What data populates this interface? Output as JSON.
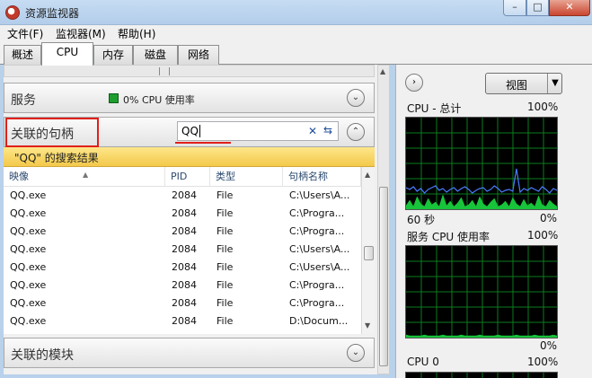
{
  "window": {
    "title": "资源监视器",
    "min_glyph": "–",
    "max_glyph": "□",
    "close_glyph": "✕"
  },
  "menu": [
    {
      "label": "文件(F)"
    },
    {
      "label": "监视器(M)"
    },
    {
      "label": "帮助(H)"
    }
  ],
  "tabs": [
    {
      "label": "概述",
      "active": false
    },
    {
      "label": "CPU",
      "active": true
    },
    {
      "label": "内存",
      "active": false
    },
    {
      "label": "磁盘",
      "active": false
    },
    {
      "label": "网络",
      "active": false
    }
  ],
  "services": {
    "title": "服务",
    "cpu_usage": "0% CPU 使用率",
    "indicator_color": "#1e9e2e"
  },
  "handles": {
    "title": "关联的句柄",
    "search_value": "QQ",
    "results_text": "\"QQ\" 的搜索结果",
    "columns": [
      "映像",
      "PID",
      "类型",
      "句柄名称"
    ],
    "rows": [
      {
        "image": "QQ.exe",
        "pid": "2084",
        "type": "File",
        "name": "C:\\Users\\A..."
      },
      {
        "image": "QQ.exe",
        "pid": "2084",
        "type": "File",
        "name": "C:\\Progra..."
      },
      {
        "image": "QQ.exe",
        "pid": "2084",
        "type": "File",
        "name": "C:\\Progra..."
      },
      {
        "image": "QQ.exe",
        "pid": "2084",
        "type": "File",
        "name": "C:\\Users\\A..."
      },
      {
        "image": "QQ.exe",
        "pid": "2084",
        "type": "File",
        "name": "C:\\Users\\A..."
      },
      {
        "image": "QQ.exe",
        "pid": "2084",
        "type": "File",
        "name": "C:\\Progra..."
      },
      {
        "image": "QQ.exe",
        "pid": "2084",
        "type": "File",
        "name": "C:\\Progra..."
      },
      {
        "image": "QQ.exe",
        "pid": "2084",
        "type": "File",
        "name": "D:\\Docum..."
      }
    ]
  },
  "modules": {
    "title": "关联的模块"
  },
  "right": {
    "view_label": "视图",
    "graphs": [
      {
        "title": "CPU - 总计",
        "max": "100%",
        "time": "60 秒",
        "min": "0%"
      },
      {
        "title": "服务 CPU 使用率",
        "max": "100%",
        "min": "0%"
      },
      {
        "title": "CPU 0",
        "max": "100%"
      }
    ]
  },
  "colors": {
    "graph_grid": "#0a7d1e",
    "cpu_line": "#4a7cff",
    "service_fill": "#17c43a",
    "highlight_red": "#e0201b"
  }
}
